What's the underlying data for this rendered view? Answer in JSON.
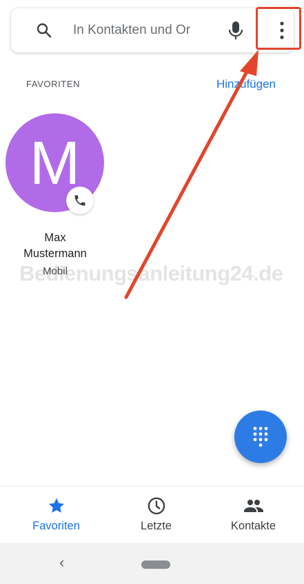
{
  "search": {
    "placeholder": "In Kontakten und Or"
  },
  "favorites": {
    "title": "FAVORITEN",
    "add_label": "Hinzufügen",
    "contacts": [
      {
        "initial": "M",
        "name_line1": "Max",
        "name_line2": "Mustermann",
        "type": "Mobil",
        "color": "#b26be8"
      }
    ]
  },
  "watermark": "Bedienungsanleitung24.de",
  "bottom_nav": {
    "items": [
      {
        "label": "Favoriten",
        "icon": "star-icon",
        "active": true
      },
      {
        "label": "Letzte",
        "icon": "clock-icon",
        "active": false
      },
      {
        "label": "Kontakte",
        "icon": "people-icon",
        "active": false
      }
    ]
  },
  "colors": {
    "accent": "#1a73e8",
    "fab": "#2d7be5",
    "avatar": "#b26be8",
    "annotation": "#e2452c"
  }
}
